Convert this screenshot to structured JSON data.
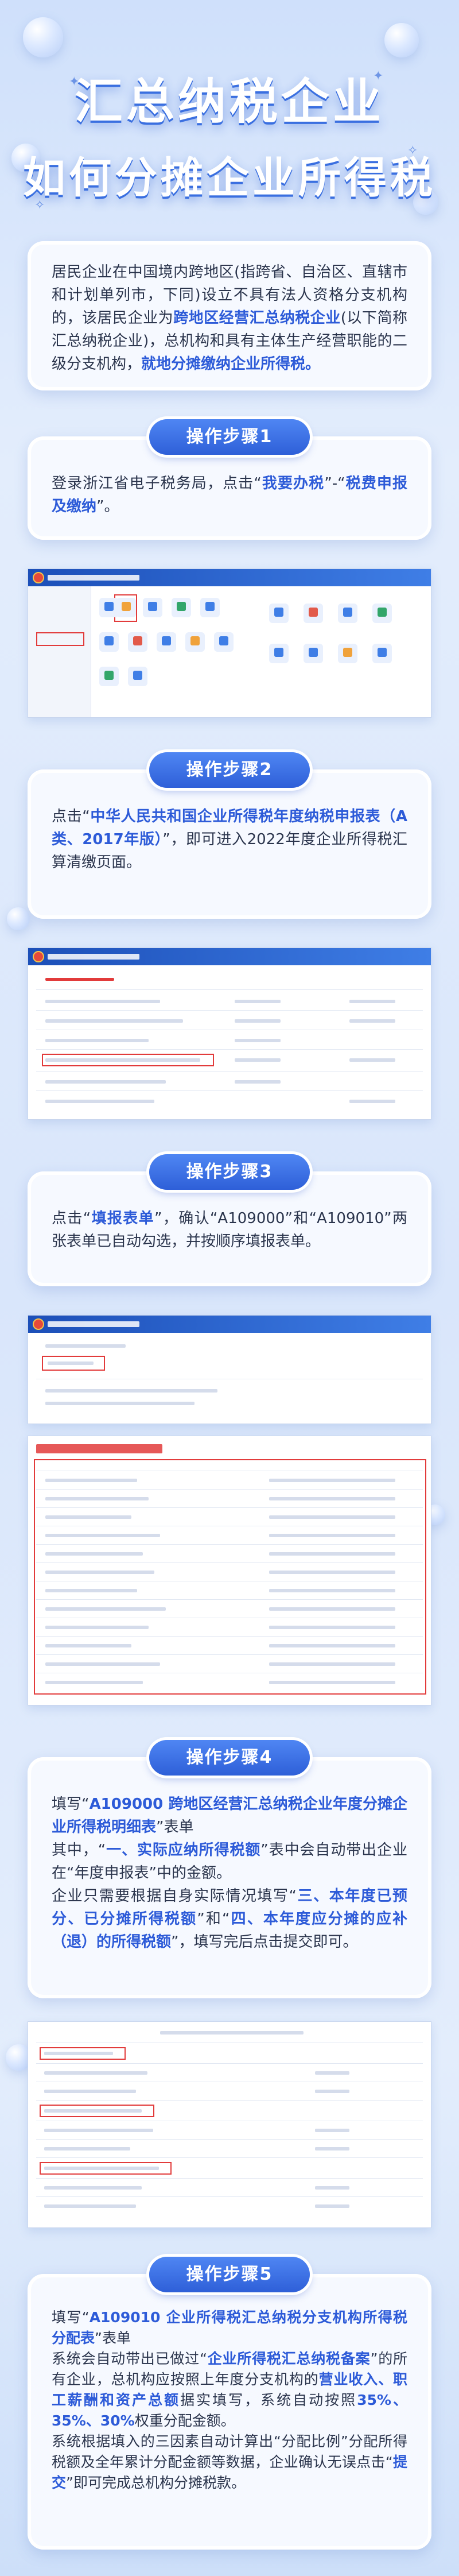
{
  "title": {
    "line1": "汇总纳税企业",
    "line2": "如何分摊企业所得税"
  },
  "intro": {
    "parts": [
      {
        "text": "居民企业在中国境内跨地区(指跨省、自治区、直辖市和计划单列市，下同)设立不具有法人资格分支机构的，该居民企业为",
        "hl": false
      },
      {
        "text": "跨地区经营汇总纳税企业",
        "hl": true
      },
      {
        "text": "(以下简称汇总纳税企业)，总机构和具有主体生产经营职能的二级分支机构，",
        "hl": false
      },
      {
        "text": "就地分摊缴纳企业所得税。",
        "hl": true
      }
    ]
  },
  "steps": [
    {
      "label": "操作步骤1",
      "parts": [
        {
          "text": "登录浙江省电子税务局，点击“",
          "hl": false
        },
        {
          "text": "我要办税",
          "hl": true
        },
        {
          "text": "”-“",
          "hl": false
        },
        {
          "text": "税费申报及缴纳",
          "hl": true
        },
        {
          "text": "”。",
          "hl": false
        }
      ]
    },
    {
      "label": "操作步骤2",
      "parts": [
        {
          "text": "点击“",
          "hl": false
        },
        {
          "text": "中华人民共和国企业所得税年度纳税申报表（A类、2017年版）",
          "hl": true
        },
        {
          "text": "”，即可进入2022年度企业所得税汇算清缴页面。",
          "hl": false
        }
      ]
    },
    {
      "label": "操作步骤3",
      "parts": [
        {
          "text": "点击“",
          "hl": false
        },
        {
          "text": "填报表单",
          "hl": true
        },
        {
          "text": "”，确认“A109000”和“A109010”两张表单已自动勾选，并按顺序填报表单。",
          "hl": false
        }
      ]
    },
    {
      "label": "操作步骤4",
      "parts": [
        {
          "text": "填写“",
          "hl": false
        },
        {
          "text": "A109000 跨地区经营汇总纳税企业年度分摊企业所得税明细表",
          "hl": true
        },
        {
          "text": "”表单\n其中，“",
          "hl": false
        },
        {
          "text": "一、实际应纳所得税额",
          "hl": true
        },
        {
          "text": "”表中会自动带出企业在“年度申报表”中的金额。\n企业只需要根据自身实际情况填写“",
          "hl": false
        },
        {
          "text": "三、本年度已预分、已分摊所得税额",
          "hl": true
        },
        {
          "text": "”和“",
          "hl": false
        },
        {
          "text": "四、本年度应分摊的应补（退）的所得税额",
          "hl": true
        },
        {
          "text": "”，填写完后点击提交即可。",
          "hl": false
        }
      ]
    },
    {
      "label": "操作步骤5",
      "parts": [
        {
          "text": "填写“",
          "hl": false
        },
        {
          "text": "A109010 企业所得税汇总纳税分支机构所得税分配表",
          "hl": true
        },
        {
          "text": "”表单\n系统会自动带出已做过“",
          "hl": false
        },
        {
          "text": "企业所得税汇总纳税备案",
          "hl": true
        },
        {
          "text": "”的所有企业，总机构应按照上年度分支机构的",
          "hl": false
        },
        {
          "text": "营业收入、职工薪酬和资产总额",
          "hl": true
        },
        {
          "text": "据实填写，系统自动按照",
          "hl": false
        },
        {
          "text": "35%、35%、30%",
          "hl": true
        },
        {
          "text": "权重分配金额。\n系统根据填入的三因素自动计算出“分配比例”分配所得税额及全年累计分配金额等数据，企业确认无误点击“",
          "hl": false
        },
        {
          "text": "提交",
          "hl": true
        },
        {
          "text": "”即可完成总机构分摊税款。",
          "hl": false
        }
      ]
    }
  ],
  "icons": {
    "bubble": "decorative-bubble-icon",
    "sparkle": "sparkle-icon"
  },
  "colors": {
    "accent": "#2d5bd8",
    "pill": "#3a6fe0",
    "highlight_box": "#e23b3b"
  }
}
